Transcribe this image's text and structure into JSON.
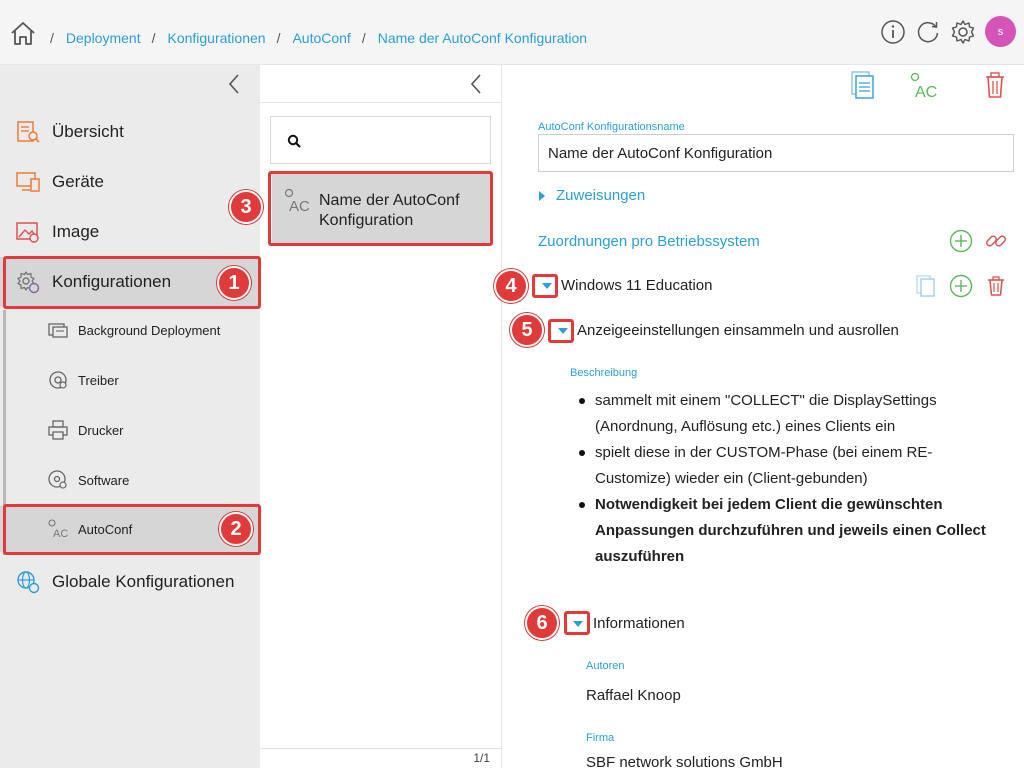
{
  "breadcrumb": {
    "items": [
      "Deployment",
      "Konfigurationen",
      "AutoConf",
      "Name der AutoConf Konfiguration"
    ]
  },
  "user": {
    "initial": "s",
    "avatar_color": "#d454b8"
  },
  "sidebar": {
    "main_items": [
      {
        "label": "Übersicht",
        "icon": "overview-icon"
      },
      {
        "label": "Geräte",
        "icon": "devices-icon"
      },
      {
        "label": "Image",
        "icon": "image-icon"
      },
      {
        "label": "Konfigurationen",
        "icon": "configurations-icon"
      }
    ],
    "sub_items": [
      {
        "label": "Background Deployment",
        "icon": "background-deployment-icon"
      },
      {
        "label": "Treiber",
        "icon": "driver-icon"
      },
      {
        "label": "Drucker",
        "icon": "printer-icon"
      },
      {
        "label": "Software",
        "icon": "software-icon"
      },
      {
        "label": "AutoConf",
        "icon": "autoconf-icon"
      }
    ],
    "bottom_item": {
      "label": "Globale Konfigurationen",
      "icon": "global-config-icon"
    }
  },
  "middle": {
    "search_value": "",
    "item_label": "Name der AutoConf Konfiguration",
    "pagination": "1/1"
  },
  "detail": {
    "name_label": "AutoConf Konfigurationsname",
    "name_value": "Name der AutoConf Konfiguration",
    "zuweisungen": "Zuweisungen",
    "zuordnungen": "Zuordnungen pro Betriebssystem",
    "os_row": "Windows 11 Education",
    "setting_row": "Anzeigeeinstellungen einsammeln und ausrollen",
    "beschreibung_label": "Beschreibung",
    "bullets": [
      "sammelt mit einem \"COLLECT\" die DisplaySettings (Anordnung, Auflösung etc.) eines Clients ein",
      "spielt diese in der CUSTOM-Phase (bei einem RE-Customize) wieder ein (Client-gebunden)"
    ],
    "bullet_bold": "Notwendigkeit bei jedem Client die gewünschten Anpassungen durchzuführen und jeweils einen Collect auszuführen",
    "info_row": "Informationen",
    "autoren_label": "Autoren",
    "autoren_value": "Raffael Knoop",
    "firma_label": "Firma",
    "firma_value": "SBF network solutions GmbH"
  },
  "callouts": [
    "1",
    "2",
    "3",
    "4",
    "5",
    "6"
  ],
  "colors": {
    "accent": "#2a9fd8",
    "callout": "#e03a3a",
    "add_green": "#5cb85c",
    "delete_red": "#e05050"
  }
}
